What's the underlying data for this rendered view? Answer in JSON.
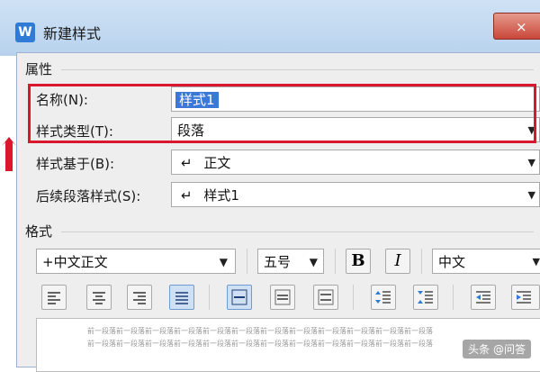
{
  "window": {
    "title": "新建样式",
    "icon": "wps-logo-icon",
    "close_glyph": "×"
  },
  "properties": {
    "group_title": "属性",
    "name_label": "名称(N):",
    "name_value": "样式1",
    "type_label": "样式类型(T):",
    "type_value": "段落",
    "based_label": "样式基于(B):",
    "based_value": "正文",
    "next_label": "后续段落样式(S):",
    "next_value": "样式1",
    "paragraph_glyph": "↵"
  },
  "format": {
    "group_title": "格式",
    "font": "+中文正文",
    "size": "五号",
    "bold": "B",
    "italic": "I",
    "script": "中文"
  },
  "preview": {
    "line1": "前一段落前一段落前一段落前一段落前一段落前一段落前一段落前一段落前一段落前一段落前一段落前一段落",
    "line2": "前一段落前一段落前一段落前一段落前一段落前一段落前一段落前一段落前一段落前一段落前一段落前一段落"
  },
  "watermark": "头条 @问答",
  "colors": {
    "highlight": "#d9172d",
    "selection": "#3b78d8"
  }
}
